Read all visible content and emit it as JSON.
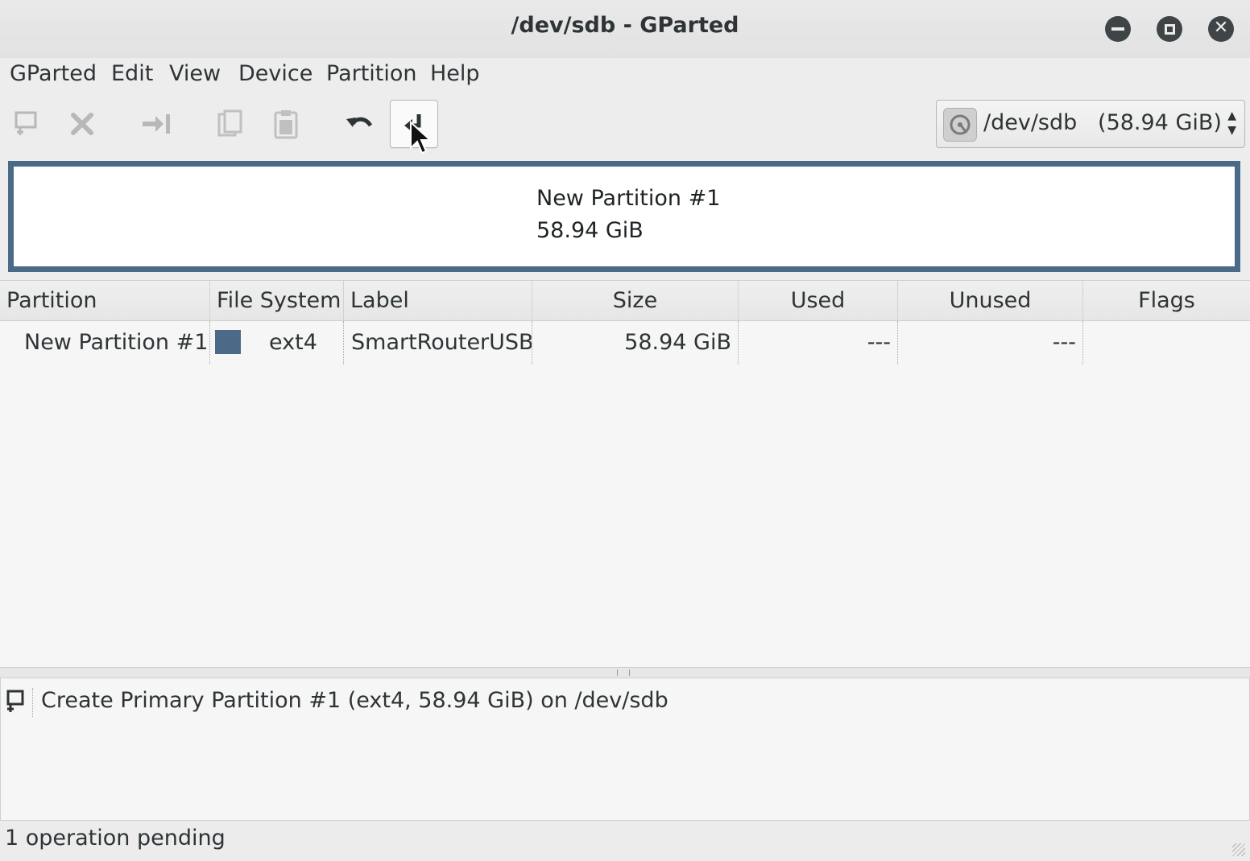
{
  "window": {
    "title": "/dev/sdb - GParted"
  },
  "menubar": {
    "items": [
      "GParted",
      "Edit",
      "View",
      "Device",
      "Partition",
      "Help"
    ]
  },
  "toolbar": {
    "buttons": [
      {
        "icon": "new-partition-icon",
        "enabled": false
      },
      {
        "icon": "delete-icon",
        "enabled": false
      },
      {
        "icon": "resize-move-icon",
        "enabled": false
      },
      {
        "icon": "copy-icon",
        "enabled": false
      },
      {
        "icon": "paste-icon",
        "enabled": false
      },
      {
        "icon": "undo-icon",
        "enabled": true
      },
      {
        "icon": "apply-icon",
        "enabled": true,
        "hovered": true
      }
    ],
    "device_selector": {
      "device": "/dev/sdb",
      "size": "(58.94 GiB)",
      "icon": "harddisk-icon"
    }
  },
  "disk_map": {
    "partition_name": "New Partition #1",
    "partition_size": "58.94 GiB",
    "color": "#4a6a87"
  },
  "partition_table": {
    "columns": [
      "Partition",
      "File System",
      "Label",
      "Size",
      "Used",
      "Unused",
      "Flags"
    ],
    "rows": [
      {
        "partition": "New Partition #1",
        "file_system": "ext4",
        "fs_color": "#4a6a87",
        "label": "SmartRouterUSB",
        "size": "58.94 GiB",
        "used": "---",
        "unused": "---",
        "flags": ""
      }
    ]
  },
  "operations": {
    "items": [
      {
        "icon": "new-partition-icon",
        "text": "Create Primary Partition #1 (ext4, 58.94 GiB) on /dev/sdb"
      }
    ]
  },
  "statusbar": {
    "text": "1 operation pending"
  }
}
